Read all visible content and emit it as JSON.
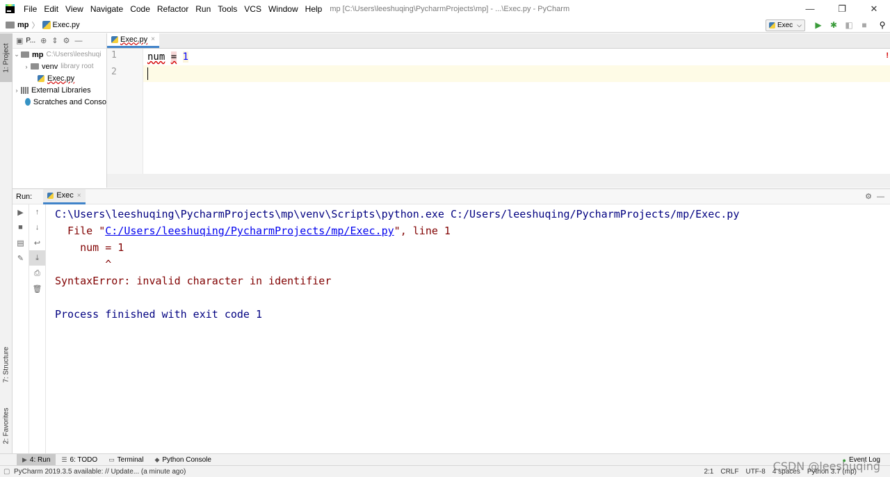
{
  "window": {
    "menu": [
      "File",
      "Edit",
      "View",
      "Navigate",
      "Code",
      "Refactor",
      "Run",
      "Tools",
      "VCS",
      "Window",
      "Help"
    ],
    "title": "mp [C:\\Users\\leeshuqing\\PycharmProjects\\mp] - ...\\Exec.py - PyCharm",
    "minimize": "—",
    "maximize": "❐",
    "close": "✕"
  },
  "navbar": {
    "project": "mp",
    "separator": "〉",
    "file": "Exec.py",
    "run_config": "Exec",
    "run_config_arrow": "⌵"
  },
  "left_stripe": {
    "project": "1: Project",
    "structure": "7: Structure",
    "favorites": "2: Favorites"
  },
  "project_panel": {
    "header_title": "P...",
    "tree": {
      "root_name": "mp",
      "root_path": "C:\\Users\\leeshuqi",
      "venv": "venv",
      "venv_note": "library root",
      "file": "Exec.py",
      "external_libs": "External Libraries",
      "scratches": "Scratches and Conso"
    }
  },
  "editor": {
    "tab": "Exec.py",
    "tab_close": "×",
    "lines": [
      "1",
      "2"
    ],
    "code": {
      "var": "num",
      "op": "=",
      "value": "1"
    }
  },
  "run_panel": {
    "label": "Run:",
    "tab": "Exec",
    "tab_close": "×",
    "console": {
      "cmd": "C:\\Users\\leeshuqing\\PycharmProjects\\mp\\venv\\Scripts\\python.exe C:/Users/leeshuqing/PycharmProjects/mp/Exec.py",
      "file_prefix": "  File \"",
      "file_link": "C:/Users/leeshuqing/PycharmProjects/mp/Exec.py",
      "file_suffix": "\", line 1",
      "code_line": "    num = 1",
      "caret_line": "        ^",
      "error": "SyntaxError: invalid character in identifier",
      "finish": "Process finished with exit code 1"
    }
  },
  "bottom_tabs": {
    "run": "4: Run",
    "todo": "6: TODO",
    "terminal": "Terminal",
    "python_console": "Python Console",
    "event_log": "Event Log"
  },
  "statusbar": {
    "message": "PyCharm 2019.3.5 available: // Update... (a minute ago)",
    "position": "2:1",
    "line_sep": "CRLF",
    "encoding": "UTF-8",
    "indent": "4 spaces",
    "interpreter": "Python 3.7 (mp)",
    "watermark": "CSDN @leeshuqing"
  }
}
